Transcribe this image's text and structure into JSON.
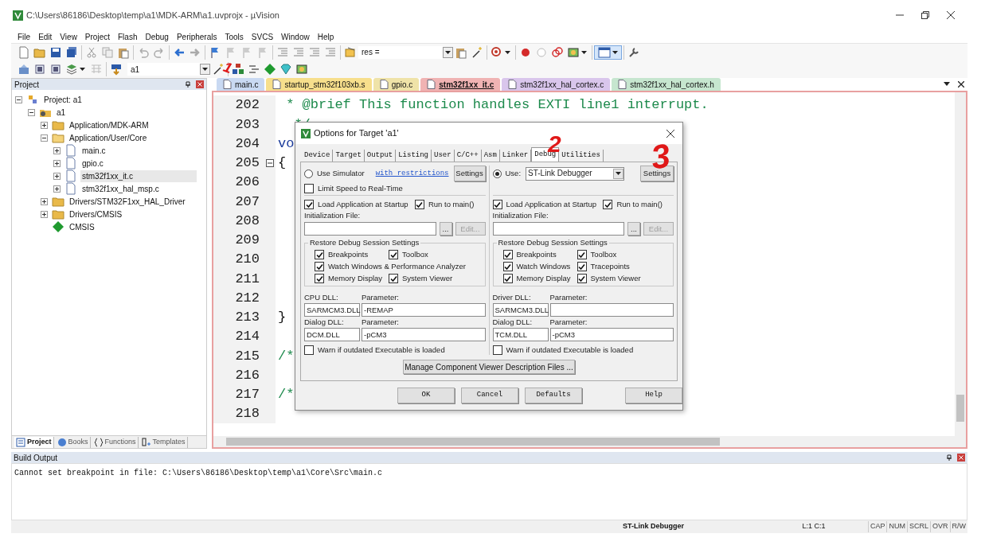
{
  "window": {
    "title": "C:\\Users\\86186\\Desktop\\temp\\a1\\MDK-ARM\\a1.uvprojx - µVision"
  },
  "menu": [
    "File",
    "Edit",
    "View",
    "Project",
    "Flash",
    "Debug",
    "Peripherals",
    "Tools",
    "SVCS",
    "Window",
    "Help"
  ],
  "toolbar": {
    "find_field": "res =",
    "target_field": "a1"
  },
  "project_panel": {
    "title": "Project",
    "tree": [
      {
        "label": "Project: a1",
        "kind": "project",
        "expanded": true,
        "selected": false,
        "children": [
          {
            "label": "a1",
            "kind": "target",
            "expanded": true,
            "selected": false,
            "children": [
              {
                "label": "Application/MDK-ARM",
                "kind": "folder",
                "expanded": false,
                "selected": false
              },
              {
                "label": "Application/User/Core",
                "kind": "folder",
                "expanded": true,
                "selected": false,
                "children": [
                  {
                    "label": "main.c",
                    "kind": "file",
                    "expanded": false,
                    "selected": false
                  },
                  {
                    "label": "gpio.c",
                    "kind": "file",
                    "expanded": false,
                    "selected": false
                  },
                  {
                    "label": "stm32f1xx_it.c",
                    "kind": "file",
                    "expanded": false,
                    "selected": true
                  },
                  {
                    "label": "stm32f1xx_hal_msp.c",
                    "kind": "file",
                    "expanded": false,
                    "selected": false
                  }
                ]
              },
              {
                "label": "Drivers/STM32F1xx_HAL_Driver",
                "kind": "folder",
                "expanded": false,
                "selected": false
              },
              {
                "label": "Drivers/CMSIS",
                "kind": "folder",
                "expanded": false,
                "selected": false
              },
              {
                "label": "CMSIS",
                "kind": "component",
                "selected": false
              }
            ]
          }
        ]
      }
    ],
    "tabs": [
      {
        "label": "Project",
        "selected": true
      },
      {
        "label": "Books",
        "selected": false
      },
      {
        "label": "Functions",
        "selected": false
      },
      {
        "label": "Templates",
        "selected": false
      }
    ]
  },
  "editor": {
    "tabs": [
      {
        "label": "main.c",
        "color": "#c9d9f2",
        "selected": false
      },
      {
        "label": "startup_stm32f103xb.s",
        "color": "#f7df8c",
        "selected": false
      },
      {
        "label": "gpio.c",
        "color": "#efe3a8",
        "selected": false
      },
      {
        "label": "stm32f1xx_it.c",
        "color": "#f0b3b3",
        "selected": true
      },
      {
        "label": "stm32f1xx_hal_cortex.c",
        "color": "#d9c6ec",
        "selected": false
      },
      {
        "label": "stm32f1xx_hal_cortex.h",
        "color": "#c6e6cf",
        "selected": false
      }
    ],
    "lines": [
      {
        "number": "202",
        "text": " * @brief This function handles EXTI line1 interrupt.",
        "kind": "comment",
        "fold": false
      },
      {
        "number": "203",
        "text": "  */",
        "kind": "comment",
        "fold": false
      },
      {
        "number": "204",
        "text": "vo",
        "kind": "keyword",
        "fold": false
      },
      {
        "number": "205",
        "text": "{",
        "kind": "plain",
        "fold": true
      },
      {
        "number": "206",
        "fold": false
      },
      {
        "number": "207",
        "fold": false
      },
      {
        "number": "208",
        "fold": false
      },
      {
        "number": "209",
        "fold": false
      },
      {
        "number": "210",
        "fold": false
      },
      {
        "number": "211",
        "fold": false
      },
      {
        "number": "212",
        "fold": false
      },
      {
        "number": "213",
        "text": "}",
        "kind": "plain",
        "fold": false
      },
      {
        "number": "214",
        "fold": false
      },
      {
        "number": "215",
        "text": "/*",
        "kind": "comment",
        "fold": false
      },
      {
        "number": "216",
        "fold": false
      },
      {
        "number": "217",
        "text": "/*",
        "kind": "comment",
        "fold": false
      },
      {
        "number": "218",
        "fold": false
      }
    ]
  },
  "dialog": {
    "title": "Options for Target 'a1'",
    "tabs": [
      {
        "label": "Device",
        "selected": false
      },
      {
        "label": "Target",
        "selected": false
      },
      {
        "label": "Output",
        "selected": false
      },
      {
        "label": "Listing",
        "selected": false
      },
      {
        "label": "User",
        "selected": false
      },
      {
        "label": "C/C++",
        "selected": false
      },
      {
        "label": "Asm",
        "selected": false
      },
      {
        "label": "Linker",
        "selected": false
      },
      {
        "label": "Debug",
        "selected": true
      },
      {
        "label": "Utilities",
        "selected": false
      }
    ],
    "left": {
      "radio": {
        "label": "Use Simulator",
        "selected": false
      },
      "link": "with restrictions",
      "settings": "Settings",
      "limit_speed": {
        "label": "Limit Speed to Real-Time",
        "checked": false
      },
      "load_app": {
        "label": "Load Application at Startup",
        "checked": true
      },
      "run_to_main": {
        "label": "Run to main()",
        "checked": true
      },
      "init_label": "Initialization File:",
      "browse": "...",
      "edit": {
        "label": "Edit...",
        "disabled": true
      },
      "restore_title": "Restore Debug Session Settings",
      "restore_rows": [
        [
          {
            "label": "Breakpoints",
            "checked": true
          },
          {
            "label": "Toolbox",
            "checked": true
          }
        ],
        [
          {
            "label": "Watch Windows & Performance Analyzer",
            "checked": true
          }
        ],
        [
          {
            "label": "Memory Display",
            "checked": true
          },
          {
            "label": "System Viewer",
            "checked": true
          }
        ]
      ],
      "dll_label": "CPU DLL:",
      "dll": "SARMCM3.DLL",
      "param_label": "Parameter:",
      "param": "-REMAP",
      "dialog_dll_label": "Dialog DLL:",
      "dialog_dll": "DCM.DLL",
      "dialog_param_label": "Parameter:",
      "dialog_param": "-pCM3",
      "warn": {
        "label": "Warn if outdated Executable is loaded",
        "checked": false
      }
    },
    "right": {
      "radio": {
        "label": "Use:",
        "selected": true
      },
      "debugger": "ST-Link Debugger",
      "settings": "Settings",
      "load_app": {
        "label": "Load Application at Startup",
        "checked": true
      },
      "run_to_main": {
        "label": "Run to main()",
        "checked": true
      },
      "init_label": "Initialization File:",
      "browse": "...",
      "edit": {
        "label": "Edit...",
        "disabled": true
      },
      "restore_title": "Restore Debug Session Settings",
      "restore_rows": [
        [
          {
            "label": "Breakpoints",
            "checked": true
          },
          {
            "label": "Toolbox",
            "checked": true
          }
        ],
        [
          {
            "label": "Watch Windows",
            "checked": true
          },
          {
            "label": "Tracepoints",
            "checked": true
          }
        ],
        [
          {
            "label": "Memory Display",
            "checked": true
          },
          {
            "label": "System Viewer",
            "checked": true
          }
        ]
      ],
      "dll_label": "Driver DLL:",
      "dll": "SARMCM3.DLL",
      "param_label": "Parameter:",
      "dialog_dll_label": "Dialog DLL:",
      "dialog_dll": "TCM.DLL",
      "dialog_param_label": "Parameter:",
      "dialog_param": "-pCM3",
      "warn": {
        "label": "Warn if outdated Executable is loaded",
        "checked": false
      }
    },
    "manage": "Manage Component Viewer Description Files ...",
    "buttons": [
      {
        "label": "OK",
        "kind": "ok"
      },
      {
        "label": "Cancel",
        "kind": "cancel"
      },
      {
        "label": "Defaults",
        "kind": "defaults"
      },
      {
        "label": "Help",
        "kind": "help"
      }
    ]
  },
  "annotations": [
    {
      "text": "1",
      "kind": "slash"
    },
    {
      "text": "2",
      "kind": "digit"
    },
    {
      "text": "3",
      "kind": "arrow"
    }
  ],
  "build_output": {
    "title": "Build Output",
    "text": "Cannot set breakpoint in file: C:\\Users\\86186\\Desktop\\temp\\a1\\Core\\Src\\main.c"
  },
  "status_bar": {
    "debugger": "ST-Link Debugger",
    "position": "L:1 C:1",
    "indicators": [
      "CAP",
      "NUM",
      "SCRL",
      "OVR",
      "R/W"
    ]
  }
}
